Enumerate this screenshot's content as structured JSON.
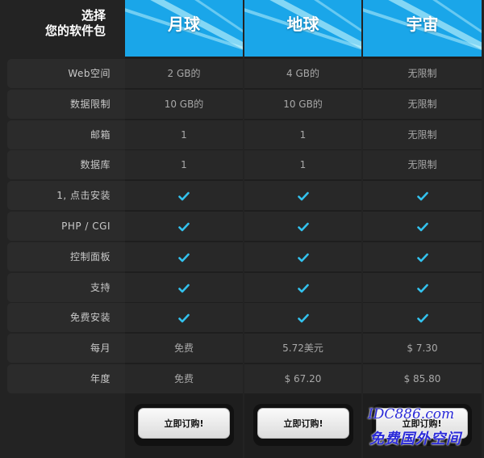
{
  "header": {
    "corner_line1": "选择",
    "corner_line2": "您的软件包",
    "plans": [
      "月球",
      "地球",
      "宇宙"
    ]
  },
  "colors": {
    "header_blue": "#1aa6e9",
    "check_blue": "#33c2ee",
    "background": "#232323"
  },
  "rows": [
    {
      "label": "Web空间",
      "values": [
        "2 GB的",
        "4 GB的",
        "无限制"
      ]
    },
    {
      "label": "数据限制",
      "values": [
        "10 GB的",
        "10 GB的",
        "无限制"
      ]
    },
    {
      "label": "邮箱",
      "values": [
        "1",
        "1",
        "无限制"
      ]
    },
    {
      "label": "数据库",
      "values": [
        "1",
        "1",
        "无限制"
      ]
    },
    {
      "label": "1, 点击安装",
      "values": [
        "check-icon",
        "check-icon",
        "check-icon"
      ]
    },
    {
      "label": "PHP / CGI",
      "values": [
        "check-icon",
        "check-icon",
        "check-icon"
      ]
    },
    {
      "label": "控制面板",
      "values": [
        "check-icon",
        "check-icon",
        "check-icon"
      ]
    },
    {
      "label": "支持",
      "values": [
        "check-icon",
        "check-icon",
        "check-icon"
      ]
    },
    {
      "label": "免费安装",
      "values": [
        "check-icon",
        "check-icon",
        "check-icon"
      ]
    },
    {
      "label": "每月",
      "values": [
        "免费",
        "5.72美元",
        "$ 7.30"
      ]
    },
    {
      "label": "年度",
      "values": [
        "免费",
        "$ 67.20",
        "$ 85.80"
      ]
    }
  ],
  "buttons": [
    "立即订购!",
    "立即订购!",
    "立即订购!"
  ],
  "watermark": {
    "line1": "IDC886.com",
    "line2": "免费国外空间"
  }
}
